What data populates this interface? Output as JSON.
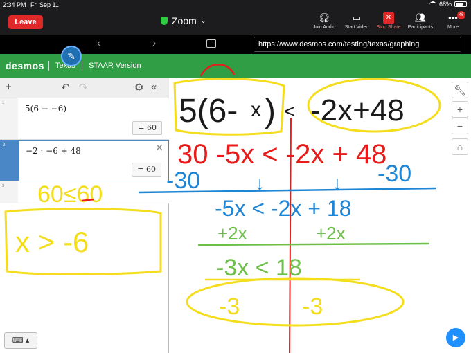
{
  "status": {
    "time": "2:34 PM",
    "date": "Fri Sep 11",
    "battery": "68%",
    "battery_fraction": 0.68
  },
  "zoom": {
    "leave_label": "Leave",
    "title": "Zoom",
    "toolbar": [
      {
        "label": "Join Audio",
        "icon": "headphones-icon"
      },
      {
        "label": "Start Video",
        "icon": "video-off-icon"
      },
      {
        "label": "Stop Share",
        "icon": "stop-share-icon"
      },
      {
        "label": "Participants",
        "icon": "participants-icon"
      },
      {
        "label": "More",
        "icon": "more-icon",
        "badge": "46"
      }
    ]
  },
  "browser": {
    "url": "https://www.desmos.com/testing/texas/graphing"
  },
  "desmos": {
    "logo": "desmos",
    "region": "Texas",
    "version": "STAAR Version"
  },
  "expressions": [
    {
      "num": "1",
      "math": "5(6 − −6)",
      "result": "= 60"
    },
    {
      "num": "2",
      "math": "−2 · −6 + 48",
      "result": "= 60"
    },
    {
      "num": "3",
      "math": "",
      "result": ""
    }
  ],
  "ink": {
    "top_left": "5(6-",
    "top_x": "x",
    "top_paren": ")",
    "lt": "<",
    "top_right": "-2x+48",
    "red_row": "30 -5x < -2x + 48",
    "blue_left": "-30",
    "blue_right": "-30",
    "blue_row": "-5x < -2x + 18",
    "green_left": "+2x",
    "green_right": "+2x",
    "row3": "-3x < 18",
    "div_left": "-3",
    "div_right": "-3",
    "check": "60≤60",
    "answer": "x > -6"
  },
  "colors": {
    "desmos_green": "#2f9e44",
    "leave_red": "#e02828",
    "ink_yellow": "#f4dd1c",
    "ink_red": "#e81b1b",
    "ink_blue": "#1f86d6",
    "ink_green": "#6cc04a"
  }
}
